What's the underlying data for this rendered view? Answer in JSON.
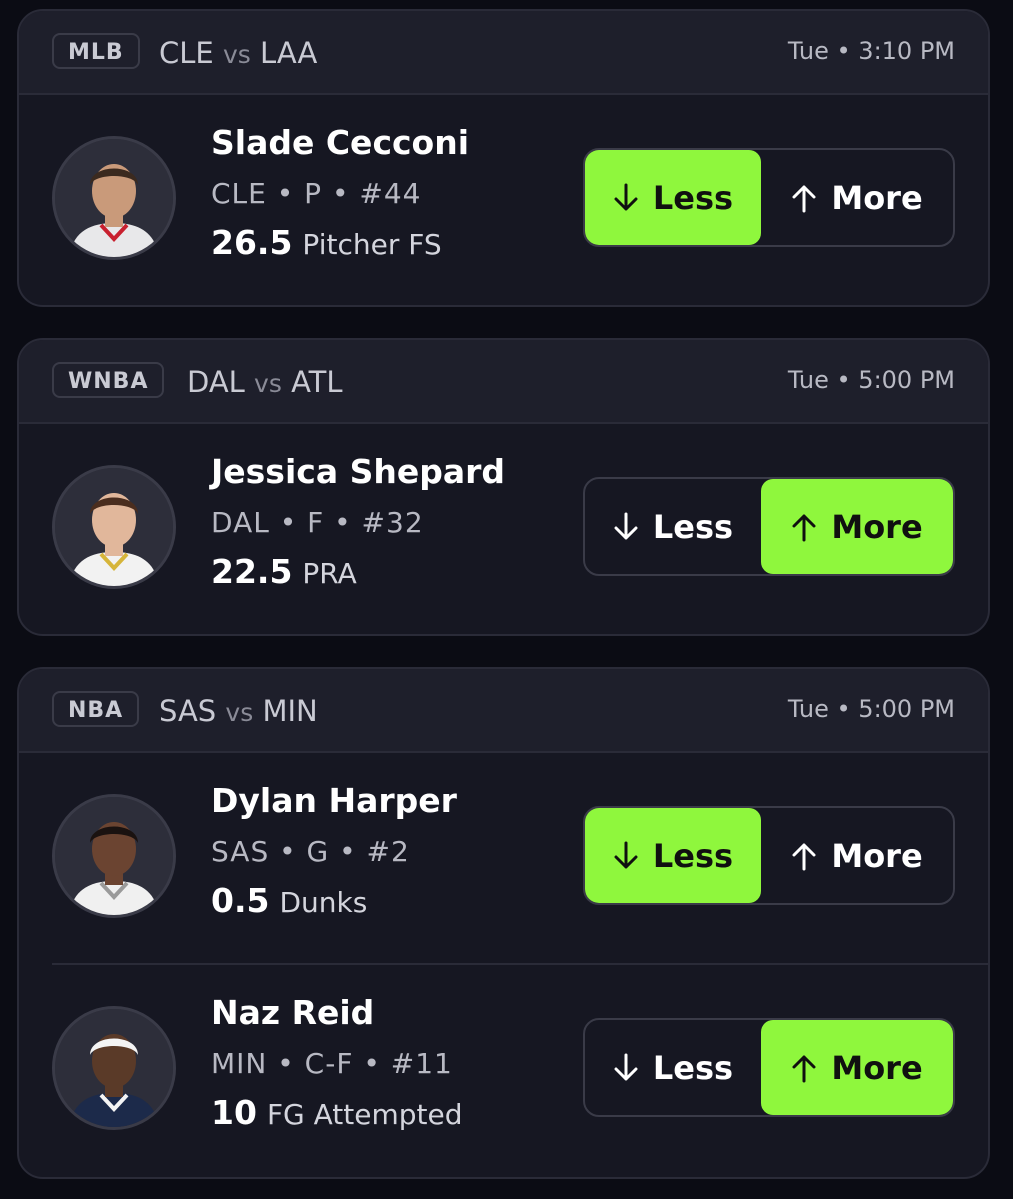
{
  "games": [
    {
      "league": "MLB",
      "team1": "CLE",
      "vs": "vs",
      "team2": "LAA",
      "time": "Tue • 3:10 PM",
      "players": [
        {
          "name": "Slade Cecconi",
          "meta": "CLE • P • #44",
          "value": "26.5",
          "stat": "Pitcher FS",
          "less_label": "Less",
          "more_label": "More",
          "selected": "less",
          "avatar": {
            "skin": "#c99a7a",
            "hair": "#3b2a1f",
            "jersey": "#e8e8ea",
            "accent": "#c8202f"
          }
        }
      ]
    },
    {
      "league": "WNBA",
      "team1": "DAL",
      "vs": "vs",
      "team2": "ATL",
      "time": "Tue • 5:00 PM",
      "players": [
        {
          "name": "Jessica Shepard",
          "meta": "DAL • F • #32",
          "value": "22.5",
          "stat": "PRA",
          "less_label": "Less",
          "more_label": "More",
          "selected": "more",
          "avatar": {
            "skin": "#e1b79b",
            "hair": "#4a2d1e",
            "jersey": "#f2f2f2",
            "accent": "#d6b53a"
          }
        }
      ]
    },
    {
      "league": "NBA",
      "team1": "SAS",
      "vs": "vs",
      "team2": "MIN",
      "time": "Tue • 5:00 PM",
      "players": [
        {
          "name": "Dylan Harper",
          "meta": "SAS • G • #2",
          "value": "0.5",
          "stat": "Dunks",
          "less_label": "Less",
          "more_label": "More",
          "selected": "less",
          "avatar": {
            "skin": "#6b4431",
            "hair": "#1a1210",
            "jersey": "#f0f0f0",
            "accent": "#9a9a9a"
          }
        },
        {
          "name": "Naz Reid",
          "meta": "MIN • C-F • #11",
          "value": "10",
          "stat": "FG Attempted",
          "less_label": "Less",
          "more_label": "More",
          "selected": "more",
          "avatar": {
            "skin": "#5a3a28",
            "hair": "#f4f4f4",
            "jersey": "#1c2a4a",
            "accent": "#f4f4f4"
          }
        }
      ]
    }
  ],
  "colors": {
    "selected": "#8ff73d",
    "card": "#161722",
    "header": "#1e1f2b",
    "background": "#0b0c14"
  },
  "icons": {
    "less": "arrow-down-icon",
    "more": "arrow-up-icon"
  }
}
